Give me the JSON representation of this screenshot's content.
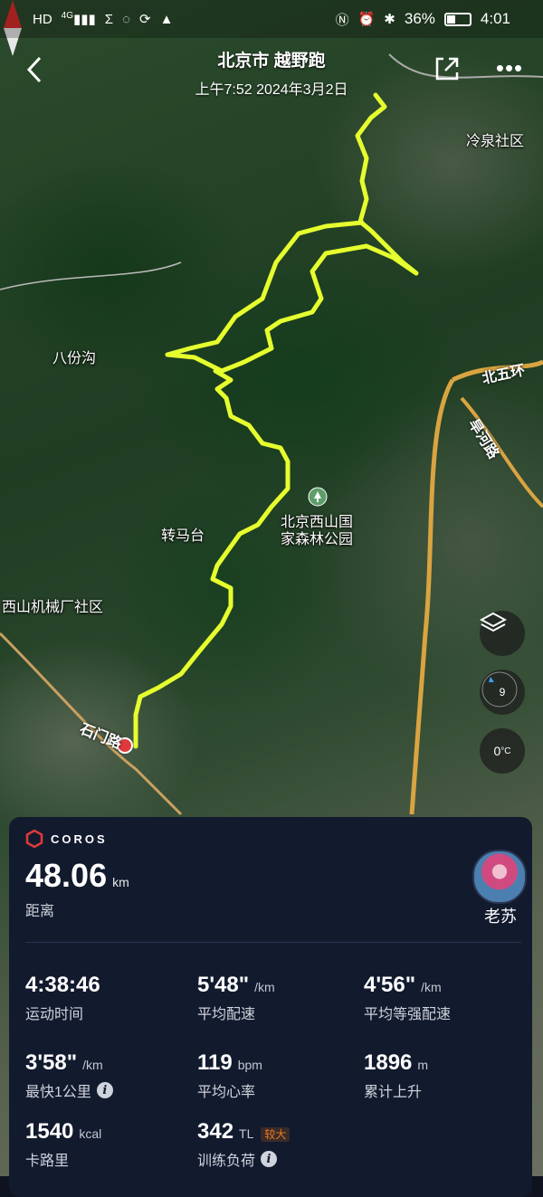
{
  "status_bar": {
    "left_icons": [
      "HD",
      "4G",
      "Σ",
      "◌",
      "⟳",
      "▲"
    ],
    "battery": "36%",
    "time": "4:01"
  },
  "header": {
    "title": "北京市 越野跑",
    "datetime": "上午7:52 2024年3月2日"
  },
  "map": {
    "labels": {
      "lengquan": "冷泉社区",
      "bafengou": "八份沟",
      "beiwuhuan": "北五环",
      "hanhelu": "旱河路",
      "park_line1": "北京西山国",
      "park_line2": "家森林公园",
      "zhuanmatai": "转马台",
      "xishan": "西山机械厂社区",
      "shimenlu": "石门路"
    },
    "compass_heading": "9",
    "temperature": "0",
    "temperature_unit": "°C",
    "route_color": "#e6ff2e"
  },
  "activity": {
    "brand": "COROS",
    "distance": "48.06",
    "distance_unit": "km",
    "distance_label": "距离",
    "username": "老苏",
    "stats": [
      {
        "value": "4:38:46",
        "unit": "",
        "label": "运动时间"
      },
      {
        "value": "5'48\"",
        "unit": "/km",
        "label": "平均配速"
      },
      {
        "value": "4'56\"",
        "unit": "/km",
        "label": "平均等强配速"
      },
      {
        "value": "3'58\"",
        "unit": "/km",
        "label": "最快1公里"
      },
      {
        "value": "119",
        "unit": "bpm",
        "label": "平均心率"
      },
      {
        "value": "1896",
        "unit": "m",
        "label": "累计上升"
      },
      {
        "value": "1540",
        "unit": "kcal",
        "label": "卡路里"
      },
      {
        "value": "342",
        "unit": "TL",
        "label": "训练负荷",
        "tag": "较大"
      }
    ]
  },
  "colors": {
    "accent": "#e6ff2e",
    "card_bg": "#121a2e",
    "brand_red": "#e0393b",
    "tag": "#f07a1a"
  }
}
